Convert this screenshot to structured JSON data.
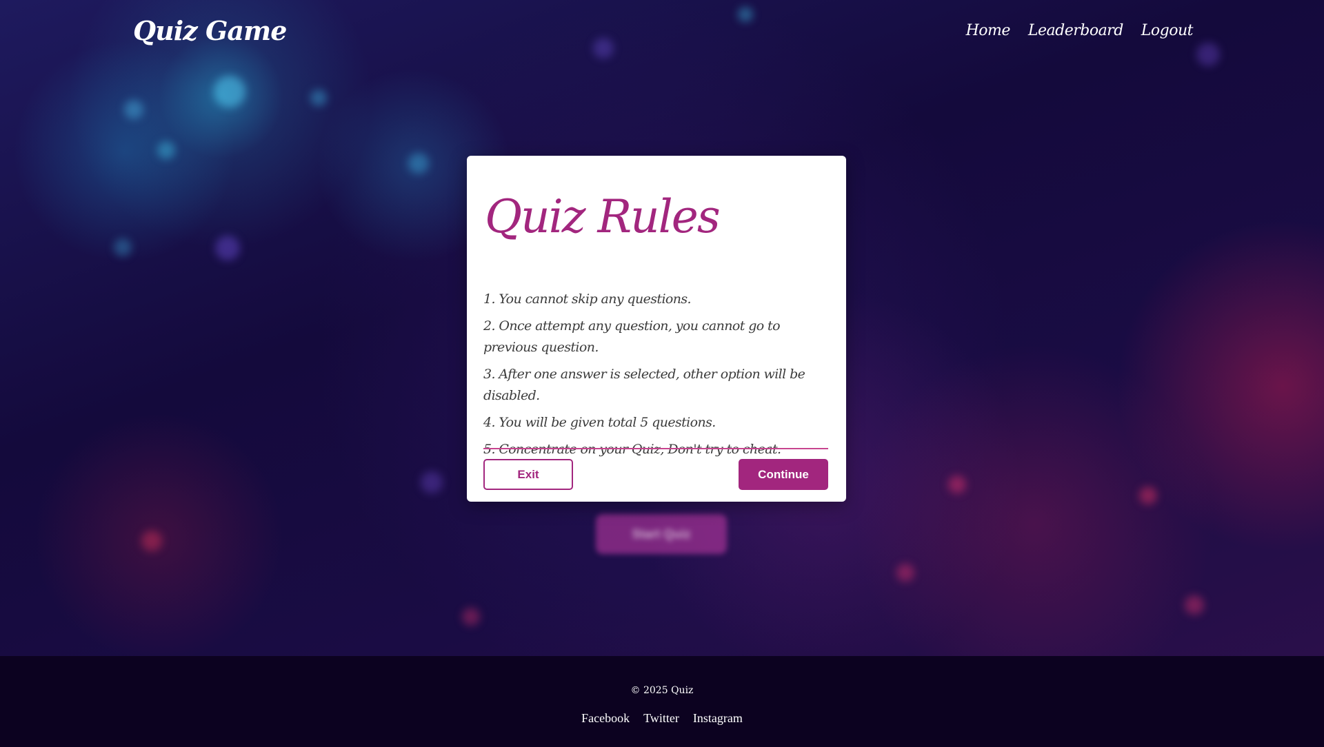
{
  "nav": {
    "brand": "Quiz Game",
    "links": [
      "Home",
      "Leaderboard",
      "Logout"
    ]
  },
  "background": {
    "start_button_label": "Start Quiz"
  },
  "rules_card": {
    "title": "Quiz Rules",
    "rules": [
      "1. You cannot skip any questions.",
      "2. Once attempt any question, you cannot go to previous question.",
      "3. After one answer is selected, other option will be disabled.",
      "4. You will be given total 5 questions.",
      "5. Concentrate on your Quiz, Don't try to cheat."
    ],
    "exit_label": "Exit",
    "continue_label": "Continue"
  },
  "footer": {
    "copyright": "© 2025 Quiz",
    "links": [
      "Facebook",
      "Twitter",
      "Instagram"
    ]
  },
  "colors": {
    "accent": "#a2267e",
    "footer_bg": "#0c0220",
    "card_bg": "#ffffff"
  }
}
